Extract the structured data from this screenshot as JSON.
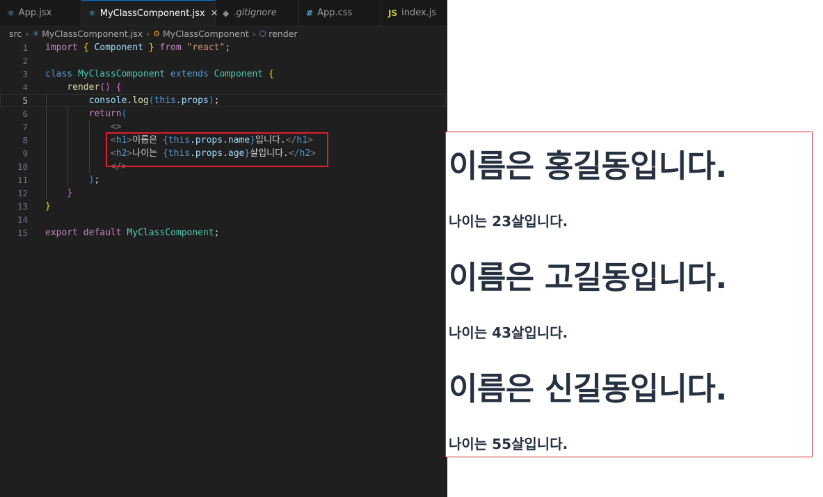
{
  "tabs": [
    {
      "label": "App.jsx",
      "icon": "react-icon"
    },
    {
      "label": "MyClassComponent.jsx",
      "icon": "react-icon",
      "active": true
    },
    {
      "label": ".gitignore",
      "icon": "git-icon"
    },
    {
      "label": "App.css",
      "icon": "css-icon"
    },
    {
      "label": "index.js",
      "icon": "js-icon"
    }
  ],
  "tab_icons": {
    "css": "#",
    "js": "JS",
    "close": "✕"
  },
  "breadcrumb": {
    "folder": "src",
    "file": "MyClassComponent.jsx",
    "class": "MyClassComponent",
    "method": "render"
  },
  "code": {
    "line_numbers": [
      "1",
      "2",
      "3",
      "4",
      "5",
      "6",
      "7",
      "8",
      "9",
      "10",
      "11",
      "12",
      "13",
      "14",
      "15"
    ],
    "l1": {
      "import": "import",
      "ob": "{",
      "name": "Component",
      "cb": "}",
      "from": "from",
      "module": "\"react\"",
      "semi": ";"
    },
    "l3": {
      "class": "class",
      "name": "MyClassComponent",
      "extends": "extends",
      "base": "Component",
      "ob": "{"
    },
    "l4": {
      "name": "render",
      "parens": "()",
      "ob": "{"
    },
    "l5": {
      "obj": "console",
      "dot": ".",
      "fn": "log",
      "op": "(",
      "this": "this",
      "dot2": ".",
      "prop": "props",
      "cp": ")",
      "semi": ";"
    },
    "l6": {
      "ret": "return",
      "op": "("
    },
    "l7": {
      "frag": "<>"
    },
    "l8": {
      "open_lt": "<",
      "tag": "h1",
      "open_gt": ">",
      "text1": "이름은 ",
      "ob": "{",
      "this": "this",
      "dot": ".",
      "props": "props",
      "dot2": ".",
      "prop": "name",
      "cb": "}",
      "text2": "입니다.",
      "close_lt": "</",
      "close_tag": "h1",
      "close_gt": ">"
    },
    "l9": {
      "open_lt": "<",
      "tag": "h2",
      "open_gt": ">",
      "text1": "나이는 ",
      "ob": "{",
      "this": "this",
      "dot": ".",
      "props": "props",
      "dot2": ".",
      "prop": "age",
      "cb": "}",
      "text2": "살입니다.",
      "close_lt": "</",
      "close_tag": "h2",
      "close_gt": ">"
    },
    "l10": {
      "frag": "</>"
    },
    "l11": {
      "cp": ")",
      "semi": ";"
    },
    "l12": {
      "cb": "}"
    },
    "l13": {
      "cb": "}"
    },
    "l15": {
      "export": "export",
      "default": "default",
      "name": "MyClassComponent",
      "semi": ";"
    }
  },
  "preview": {
    "items": [
      {
        "name_line": "이름은 홍길동입니다.",
        "age_line": "나이는 23살입니다."
      },
      {
        "name_line": "이름은 고길동입니다.",
        "age_line": "나이는 43살입니다."
      },
      {
        "name_line": "이름은 신길동입니다.",
        "age_line": "나이는 55살입니다."
      }
    ]
  },
  "colors": {
    "highlight_border": "#e11d2a",
    "preview_text": "#273142",
    "editor_bg": "#1f1f1f"
  }
}
